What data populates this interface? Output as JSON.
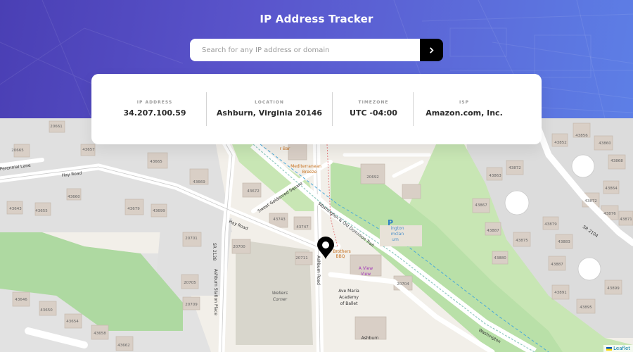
{
  "header": {
    "title": "IP Address Tracker",
    "bg_start": "#4a3fb4",
    "bg_end": "#5d7fe6"
  },
  "search": {
    "placeholder": "Search for any IP address or domain",
    "value": "",
    "submit_icon": "chevron-right-icon"
  },
  "info": {
    "ip": {
      "label": "IP ADDRESS",
      "value": "34.207.100.59"
    },
    "location": {
      "label": "LOCATION",
      "value": "Ashburn, Virginia 20146"
    },
    "timezone": {
      "label": "TIMEZONE",
      "value": "UTC -04:00"
    },
    "isp": {
      "label": "ISP",
      "value": "Amazon.com, Inc."
    }
  },
  "map": {
    "marker_icon": "location-pin-icon",
    "roads": {
      "perennial": "Perennial Lane",
      "hay1": "Hay Road",
      "hay2": "Hay Road",
      "goldenrod": "Sweet Goldenrod Square",
      "wod": "Washington & Old Dominion Trail",
      "wod2": "Washington",
      "ashburn_rd": "Ashburn Road",
      "sr2128": "SR 2128",
      "station": "Ashburn Station Place",
      "sr2104": "SR 2104"
    },
    "places": {
      "mediterranean": "Mediterranean",
      "breeze": "Breeze",
      "lbar": "r Bar",
      "wellers": "Wellers",
      "corner": "Corner",
      "avemaria1": "Ave Maria",
      "avemaria2": "Academy",
      "avemaria3": "of Ballet",
      "ashburn": "Ashburn",
      "aview1": "A View",
      "aview2": "View",
      "parking": "P",
      "brothers": "Brothers",
      "bbq": "BBQ",
      "ington": "ington",
      "mclan": "mclan",
      "um": "um"
    },
    "addr": {
      "a1": "20661",
      "a2": "20665",
      "a3": "43657",
      "a4": "43665",
      "a5": "43669",
      "a6": "43660",
      "a7": "43643",
      "a8": "43655",
      "a9": "43679",
      "a10": "43699",
      "a11": "43672",
      "a12": "43743",
      "a13": "43747",
      "a14": "20701",
      "a15": "20700",
      "a16": "20711",
      "a17": "20705",
      "a18": "20709",
      "a19": "43646",
      "a20": "43650",
      "a21": "43654",
      "a22": "43658",
      "a23": "43662",
      "a24": "20692",
      "a25": "20704",
      "a26": "43856",
      "a27": "43852",
      "a28": "43860",
      "a29": "43868",
      "a30": "43872",
      "a31": "43863",
      "a32": "43867",
      "a33": "43864",
      "a34": "43868",
      "a35": "43872",
      "a36": "43876",
      "a37": "43879",
      "a38": "43875",
      "a39": "43883",
      "a40": "43887",
      "a41": "43887",
      "a42": "43891",
      "a43": "43895",
      "a44": "43899",
      "a45": "43880",
      "a46": "43871"
    }
  },
  "attribution": {
    "label": "Leaflet"
  }
}
